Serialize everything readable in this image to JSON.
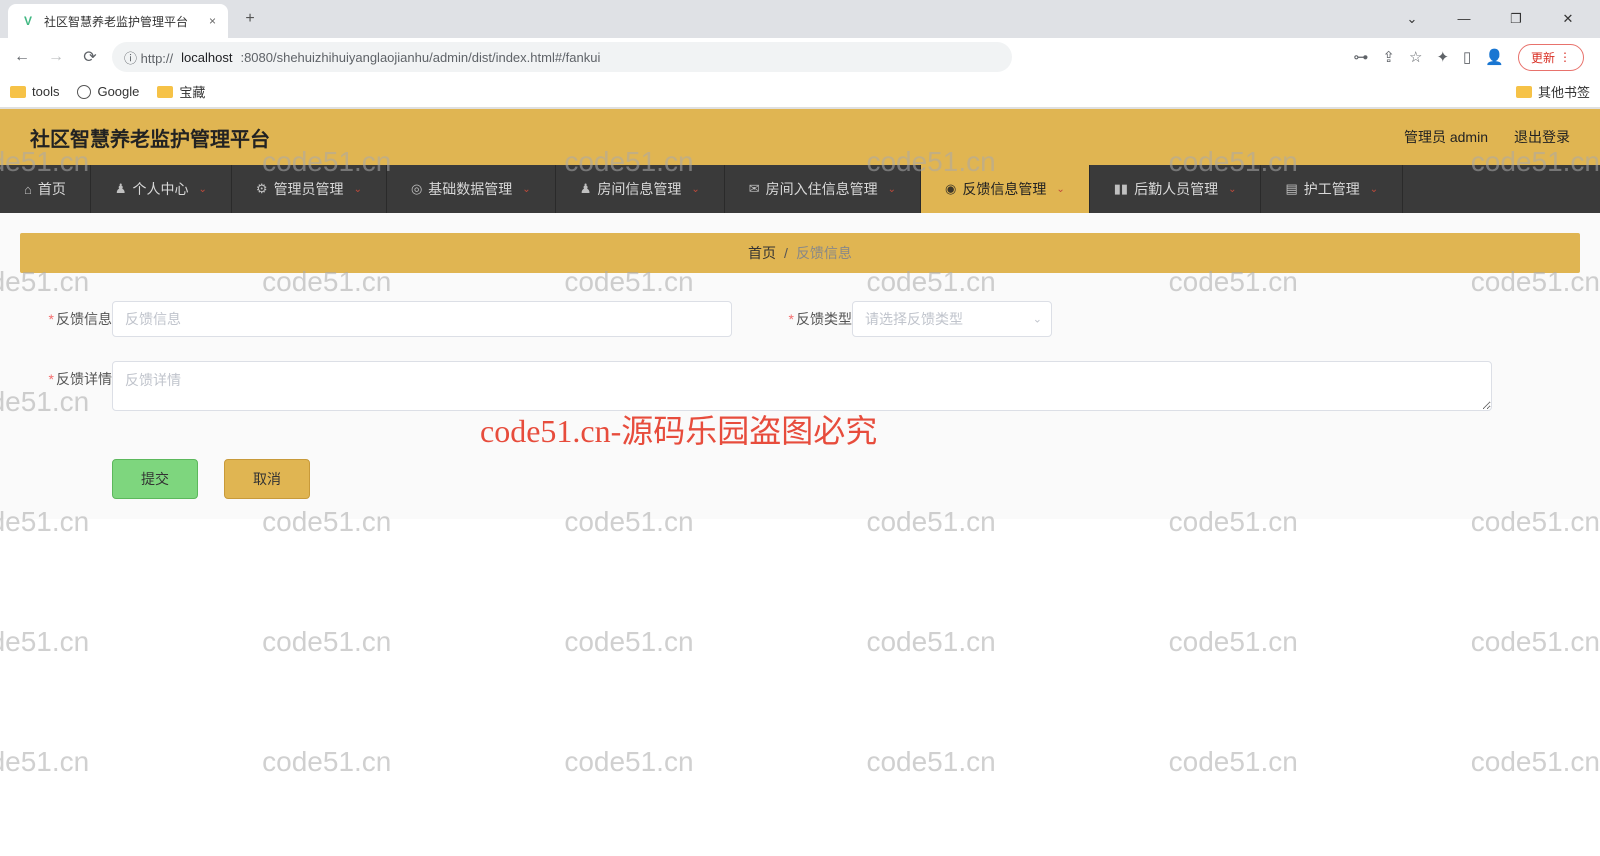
{
  "browser": {
    "tab_title": "社区智慧养老监护管理平台",
    "url_scheme": "ⓘ  http://",
    "url_host": "localhost",
    "url_port_path": ":8080/shehuizhihuiyanglaojianhu/admin/dist/index.html#/fankui",
    "update_label": "更新",
    "bookmarks": {
      "tools": "tools",
      "google": "Google",
      "treasure": "宝藏",
      "other": "其他书签"
    }
  },
  "header": {
    "title": "社区智慧养老监护管理平台",
    "admin_label": "管理员 admin",
    "logout": "退出登录"
  },
  "nav": [
    {
      "icon": "home-icon",
      "glyph": "⌂",
      "label": "首页",
      "caret": false
    },
    {
      "icon": "user-icon",
      "glyph": "♟",
      "label": "个人中心",
      "caret": true
    },
    {
      "icon": "gear-icon",
      "glyph": "⚙",
      "label": "管理员管理",
      "caret": true
    },
    {
      "icon": "data-icon",
      "glyph": "◎",
      "label": "基础数据管理",
      "caret": true
    },
    {
      "icon": "room-icon",
      "glyph": "♟",
      "label": "房间信息管理",
      "caret": true
    },
    {
      "icon": "checkin-icon",
      "glyph": "✉",
      "label": "房间入住信息管理",
      "caret": true
    },
    {
      "icon": "feedback-icon",
      "glyph": "◉",
      "label": "反馈信息管理",
      "caret": true,
      "active": true
    },
    {
      "icon": "staff-icon",
      "glyph": "▮▮",
      "label": "后勤人员管理",
      "caret": true
    },
    {
      "icon": "nurse-icon",
      "glyph": "▤",
      "label": "护工管理",
      "caret": true
    }
  ],
  "breadcrumb": {
    "home": "首页",
    "sep": "/",
    "current": "反馈信息"
  },
  "form": {
    "info_label": "反馈信息",
    "info_placeholder": "反馈信息",
    "type_label": "反馈类型",
    "type_placeholder": "请选择反馈类型",
    "detail_label": "反馈详情",
    "detail_placeholder": "反馈详情",
    "submit": "提交",
    "cancel": "取消"
  },
  "watermark": {
    "text": "code51.cn",
    "red_text": "code51.cn-源码乐园盗图必究"
  }
}
